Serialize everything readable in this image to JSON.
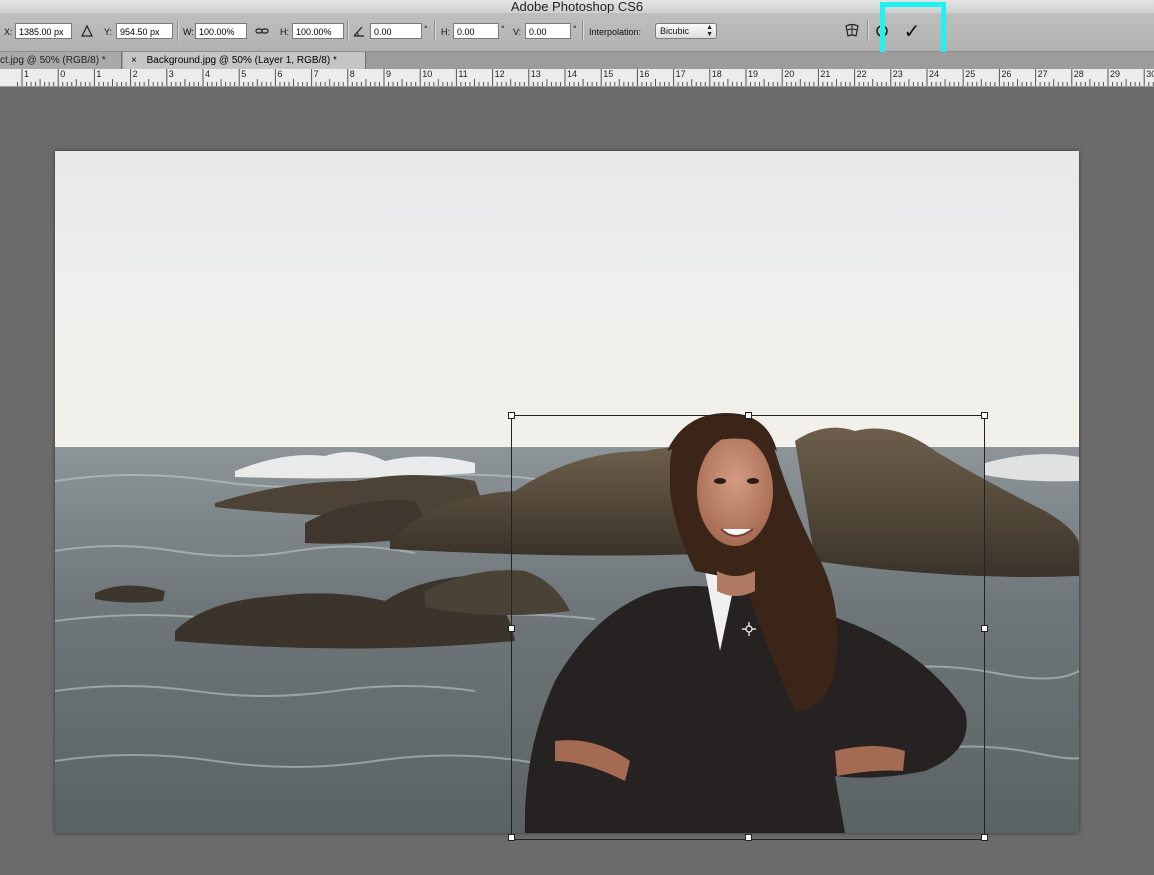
{
  "app": {
    "title": "Adobe Photoshop CS6"
  },
  "options_bar": {
    "x_label": "X:",
    "x_value": "1385.00 px",
    "y_label": "Y:",
    "y_value": "954.50 px",
    "w_label": "W:",
    "w_value": "100.00%",
    "h_label": "H:",
    "h_value": "100.00%",
    "angle_value": "0.00",
    "angle_unit": "°",
    "hskew_label": "H:",
    "hskew_value": "0.00",
    "hskew_unit": "°",
    "vskew_label": "V:",
    "vskew_value": "0.00",
    "vskew_unit": "°",
    "interpolation_label": "Interpolation:",
    "interpolation_value": "Bicubic",
    "commit_symbol": "✓"
  },
  "tabs": [
    {
      "label": "ct.jpg @ 50% (RGB/8) *",
      "active": false
    },
    {
      "label": "Background.jpg @ 50% (Layer 1, RGB/8) *",
      "active": true,
      "close": "×"
    }
  ],
  "ruler": {
    "labels": [
      "1",
      "0",
      "1",
      "2",
      "3",
      "4",
      "5",
      "6",
      "7",
      "8",
      "9",
      "10",
      "11",
      "12",
      "13",
      "14",
      "15",
      "16",
      "17",
      "18",
      "19",
      "20",
      "21",
      "22",
      "23",
      "24",
      "25",
      "26",
      "27",
      "28",
      "29",
      "30"
    ]
  },
  "colors": {
    "highlight": "#1ef2f2",
    "canvas_bg": "#6b6b6b"
  },
  "icons": [
    "triangle-delta-icon",
    "link-chain-icon",
    "angle-icon",
    "warp-mode-icon",
    "cancel-transform-icon",
    "commit-check-icon"
  ]
}
